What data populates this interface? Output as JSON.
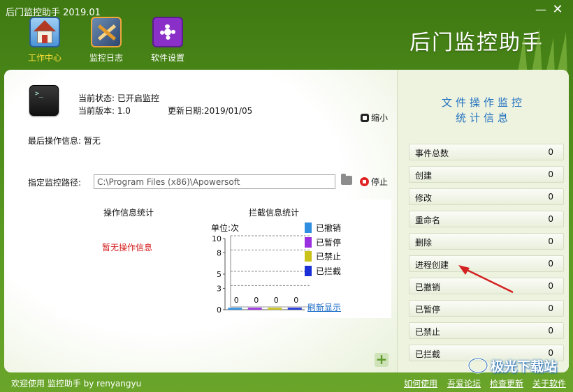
{
  "window": {
    "title": "后门监控助手 2019.01",
    "min_icon": "minimize-icon",
    "close_icon": "close-icon"
  },
  "toolbar": {
    "items": [
      {
        "label": "工作中心",
        "icon": "home-icon",
        "active": true
      },
      {
        "label": "监控日志",
        "icon": "log-icon",
        "active": false
      },
      {
        "label": "软件设置",
        "icon": "gear-icon",
        "active": false
      }
    ]
  },
  "brand": "后门监控助手",
  "status": {
    "state": "当前状态: 已开启监控",
    "version": "当前版本: 1.0",
    "updated": "更新日期:2019/01/05",
    "last_op": "最后操作信息: 暂无",
    "shrink_label": "缩小"
  },
  "path": {
    "label": "指定监控路径:",
    "value": "C:\\Program Files (x86)\\Apowersoft",
    "stop_label": "停止"
  },
  "op_stats": {
    "title": "操作信息统计",
    "empty": "暂无操作信息"
  },
  "chart_data": {
    "type": "bar",
    "title": "拦截信息统计",
    "ylabel": "单位:次",
    "ylim": [
      0,
      10
    ],
    "yticks": [
      0,
      3,
      5,
      8,
      10
    ],
    "categories": [
      "已撤销",
      "已暂停",
      "已禁止",
      "已拦截"
    ],
    "values": [
      0,
      0,
      0,
      0
    ],
    "colors": [
      "#2f8ee0",
      "#9a2fe0",
      "#c9c21a",
      "#1a2fd6"
    ],
    "legend_position": "right",
    "grid": true
  },
  "refresh_label": "刷新显示",
  "stats_panel": {
    "title_line1": "文件操作监控",
    "title_line2": "统计信息",
    "rows": [
      {
        "name": "事件总数",
        "value": "0"
      },
      {
        "name": "创建",
        "value": "0"
      },
      {
        "name": "修改",
        "value": "0"
      },
      {
        "name": "重命名",
        "value": "0"
      },
      {
        "name": "删除",
        "value": "0"
      },
      {
        "name": "进程创建",
        "value": "0"
      },
      {
        "name": "已撤销",
        "value": "0"
      },
      {
        "name": "已暂停",
        "value": "0"
      },
      {
        "name": "已禁止",
        "value": "0"
      },
      {
        "name": "已拦截",
        "value": "0"
      }
    ]
  },
  "footer": {
    "welcome": "欢迎使用 监控助手  by  renyangyu",
    "links": [
      "如何使用",
      "吾爱论坛",
      "检查更新",
      "关于软件"
    ]
  },
  "watermark": "极光下载站"
}
